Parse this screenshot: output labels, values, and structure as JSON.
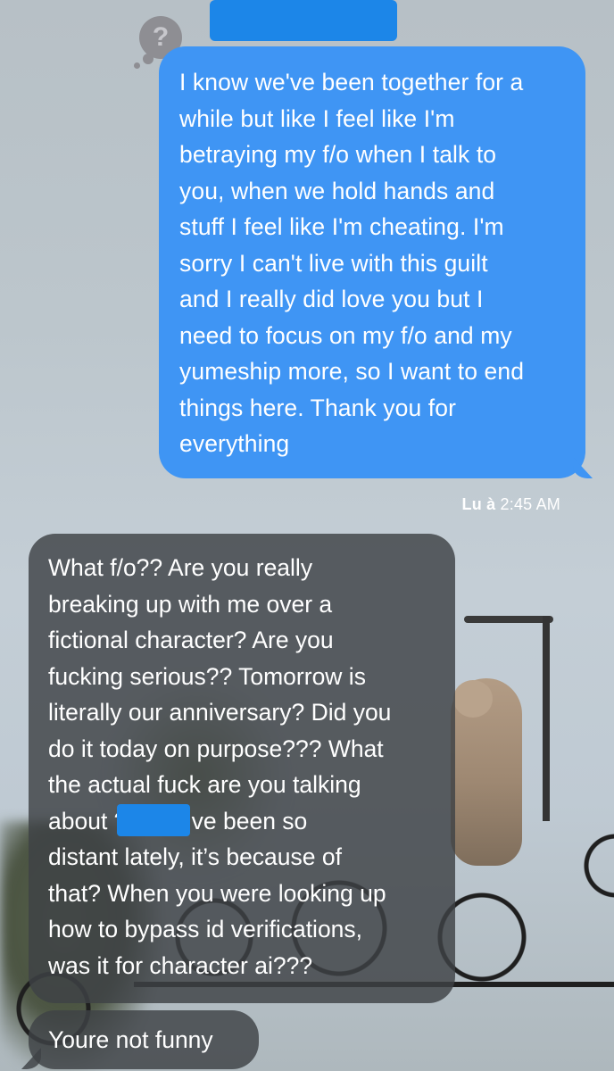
{
  "thread": {
    "avatar_glyph": "?",
    "sent_message_lines": [
      "I know we've been together for a",
      "while but like I feel like I'm",
      "betraying my f/o when I talk to",
      "you, when we hold hands and",
      "stuff I feel like I'm cheating. I'm",
      "sorry I can't live with this guilt",
      "and I really did love you but I",
      "need to focus on my f/o and my",
      "yumeship more, so I want to end",
      "things here. Thank you for",
      "everything"
    ],
    "read_receipt_label": "Lu à",
    "read_receipt_time": "2:45 AM",
    "received_message_lines": [
      "What f/o?? Are you really",
      "breaking up with me over a",
      "fictional character? Are you",
      "fucking serious?? Tomorrow is",
      "literally our anniversary? Did you",
      "do it today on purpose??? What",
      "the actual fuck are you talking",
      "about           ?? You’ve been so",
      "distant lately, it’s because of",
      "that? When you were looking up",
      "how to bypass id verifications,",
      "was it for character ai???"
    ],
    "received_message_2": "Youre not funny",
    "colors": {
      "sent_bubble": "#3f95f4",
      "received_bubble": "#3e4246",
      "redaction": "#1c86e8"
    }
  }
}
